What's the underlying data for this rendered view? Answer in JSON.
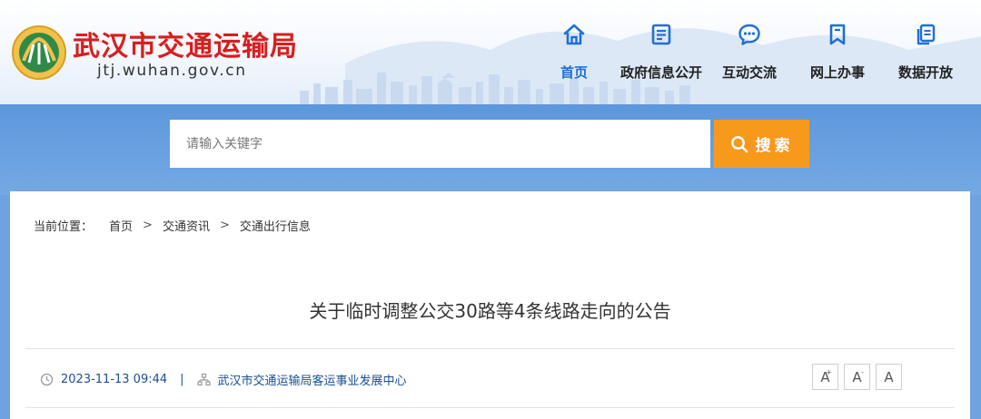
{
  "header": {
    "site_name": "武汉市交通运输局",
    "site_url": "jtj.wuhan.gov.cn",
    "nav": [
      {
        "label": "首页",
        "icon": "home-icon",
        "active": true
      },
      {
        "label": "政府信息公开",
        "icon": "document-icon",
        "active": false
      },
      {
        "label": "互动交流",
        "icon": "chat-bubble-icon",
        "active": false
      },
      {
        "label": "网上办事",
        "icon": "bookmark-icon",
        "active": false
      },
      {
        "label": "数据开放",
        "icon": "data-copy-icon",
        "active": false
      }
    ]
  },
  "search": {
    "placeholder": "请输入关键字",
    "button_label": "搜索"
  },
  "breadcrumb": {
    "prefix": "当前位置：",
    "items": [
      "首页",
      "交通资讯",
      "交通出行信息"
    ],
    "separator": ">"
  },
  "article": {
    "title": "关于临时调整公交30路等4条线路走向的公告",
    "date": "2023-11-13 09:44",
    "meta_separator": "|",
    "source": "武汉市交通运输局客运事业发展中心",
    "font_controls": [
      {
        "label": "A",
        "sup": "+"
      },
      {
        "label": "A",
        "sup": "-"
      },
      {
        "label": "A",
        "sup": ""
      }
    ]
  },
  "colors": {
    "brand_red": "#d81e1e",
    "nav_active": "#1f6fd6",
    "search_button": "#f79a1c",
    "band_blue": "#6fa3df",
    "meta_blue": "#1a4e93"
  }
}
